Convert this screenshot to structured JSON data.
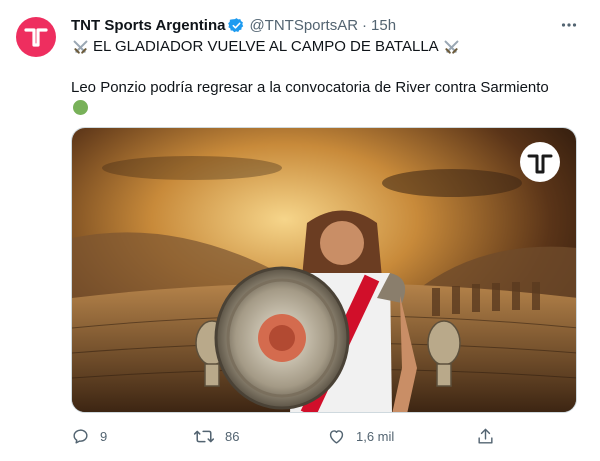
{
  "author": {
    "name": "TNT Sports Argentina",
    "handle": "@TNTSportsAR",
    "separator": "·",
    "time": "15h"
  },
  "tweet": {
    "headline": "EL GLADIADOR VUELVE AL CAMPO DE BATALLA",
    "body": "Leo Ponzio podría regresar a la convocatoria de River contra Sarmiento"
  },
  "icons": {
    "avatar": "tnt-logo-icon",
    "verified": "verified-badge-icon",
    "emoji_swords": "crossed-swords-icon",
    "emoji_circle": "green-circle-icon",
    "more": "more-icon",
    "reply": "reply-icon",
    "retweet": "retweet-icon",
    "like": "heart-icon",
    "share": "share-icon"
  },
  "stats": {
    "replies": "9",
    "retweets": "86",
    "likes": "1,6 mil"
  },
  "colors": {
    "brand": "#ee2e5f",
    "verified": "#1d9bf0",
    "secondary_text": "#536471"
  }
}
